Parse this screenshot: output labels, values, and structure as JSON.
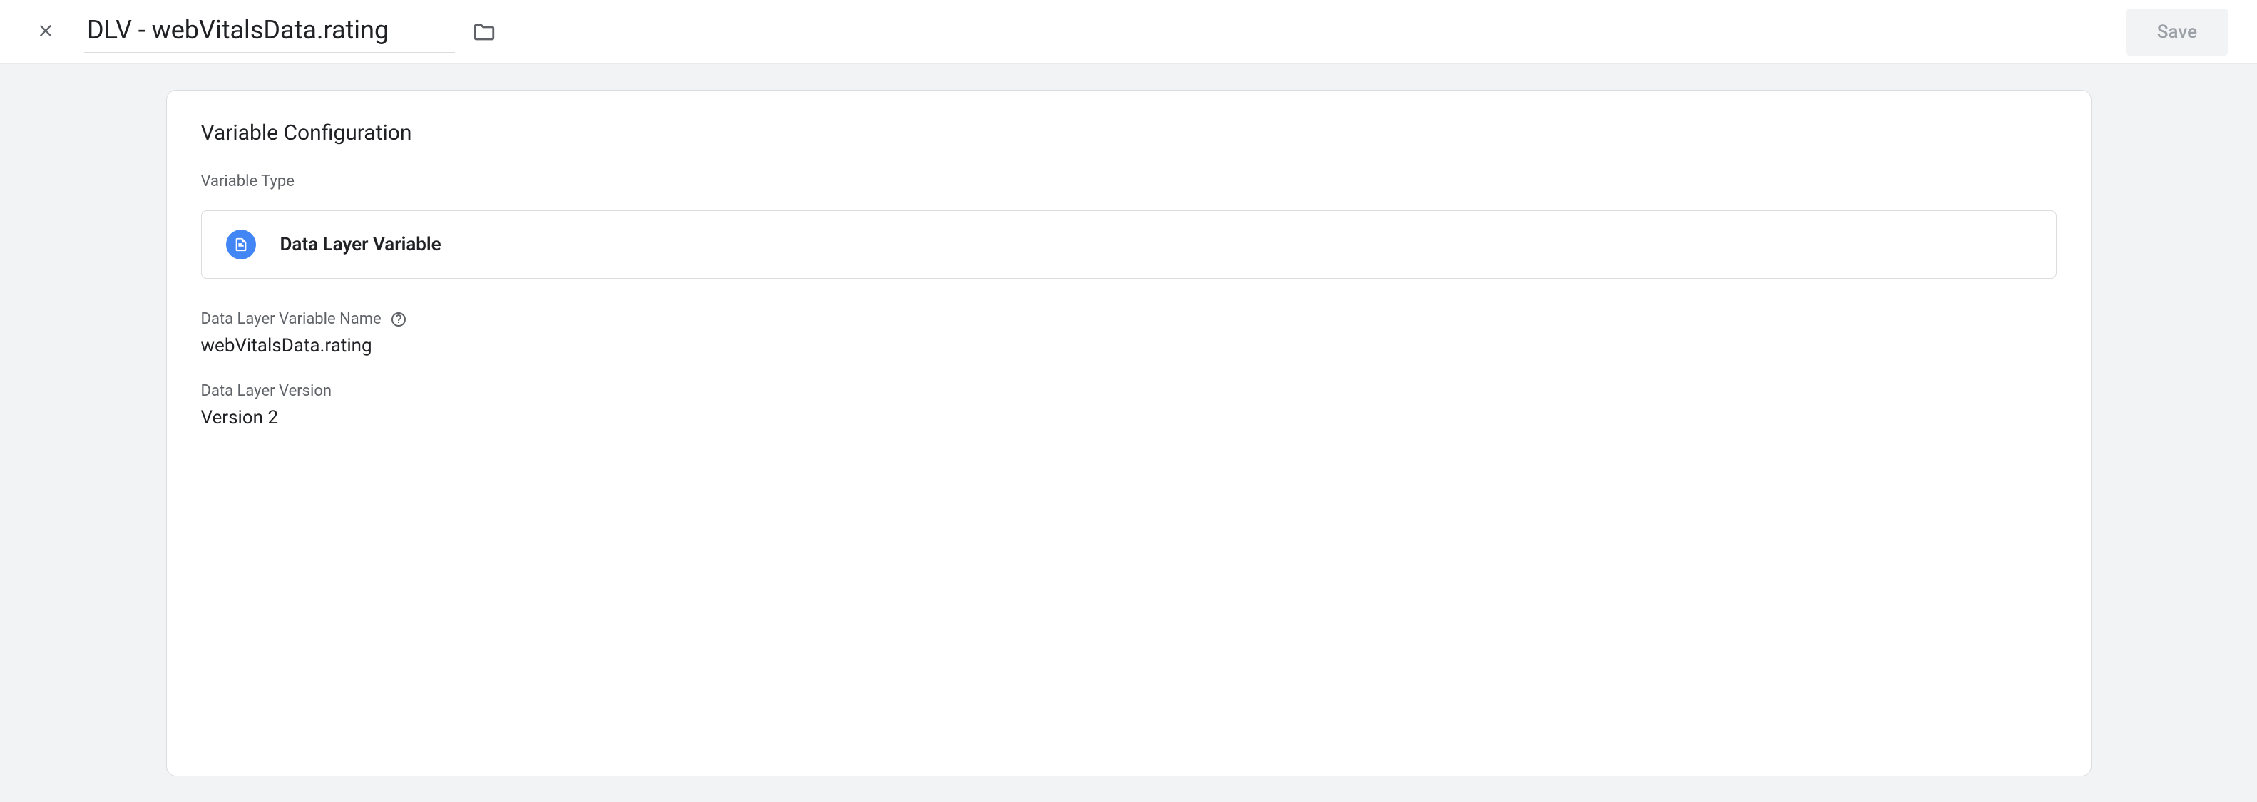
{
  "header": {
    "title": "DLV - webVitalsData.rating",
    "save_label": "Save"
  },
  "config": {
    "section_title": "Variable Configuration",
    "type_label": "Variable Type",
    "type_value": "Data Layer Variable",
    "name_label": "Data Layer Variable Name",
    "name_value": "webVitalsData.rating",
    "version_label": "Data Layer Version",
    "version_value": "Version 2"
  }
}
